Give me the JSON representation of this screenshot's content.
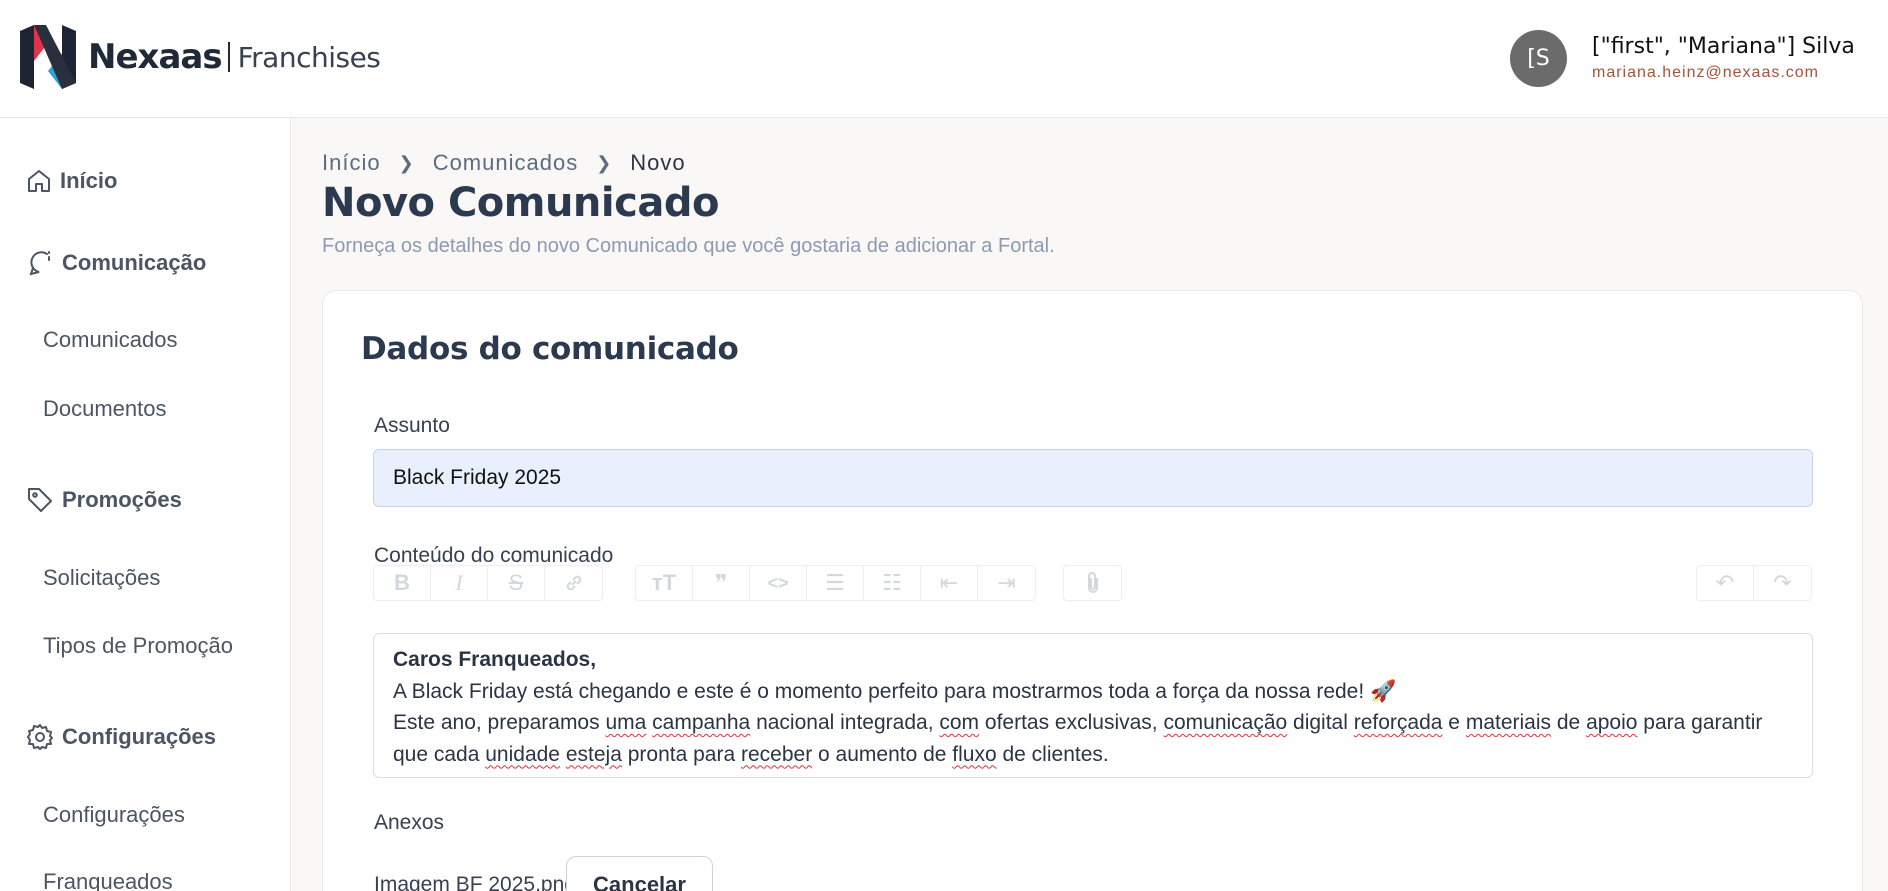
{
  "header": {
    "brand_name": "Nexaas",
    "brand_product": "Franchises",
    "avatar_initials": "[S",
    "user_name": "[\"first\", \"Mariana\"] Silva",
    "user_email": "mariana.heinz@nexaas.com"
  },
  "sidebar": {
    "sections": [
      {
        "label": "Início",
        "icon": "home-icon"
      },
      {
        "label": "Comunicação",
        "icon": "chat-icon"
      },
      {
        "label": "Promoções",
        "icon": "tag-icon"
      },
      {
        "label": "Configurações",
        "icon": "gear-icon"
      }
    ],
    "items": [
      "Comunicados",
      "Documentos",
      "Solicitações",
      "Tipos de Promoção",
      "Configurações",
      "Franqueados"
    ]
  },
  "breadcrumb": [
    "Início",
    "Comunicados",
    "Novo"
  ],
  "page": {
    "title": "Novo Comunicado",
    "description": "Forneça os detalhes do novo Comunicado que você gostaria de adicionar a Fortal."
  },
  "form": {
    "card_title": "Dados do comunicado",
    "subject_label": "Assunto",
    "subject_value": "Black Friday 2025",
    "content_label": "Conteúdo do comunicado",
    "content": {
      "greeting": "Caros Franqueados,",
      "line1": "A Black Friday está chegando e este é o momento perfeito para mostrarmos toda a força da nossa rede! 🚀"
    },
    "attachments_label": "Anexos",
    "attachment_name": "Imagem BF 2025.png",
    "cancel_label": "Cancelar"
  },
  "colors": {
    "accent_red": "#e0344b",
    "accent_blue": "#2fa3d8",
    "email": "#a3543a",
    "subject_bg": "#e8f0fe"
  }
}
